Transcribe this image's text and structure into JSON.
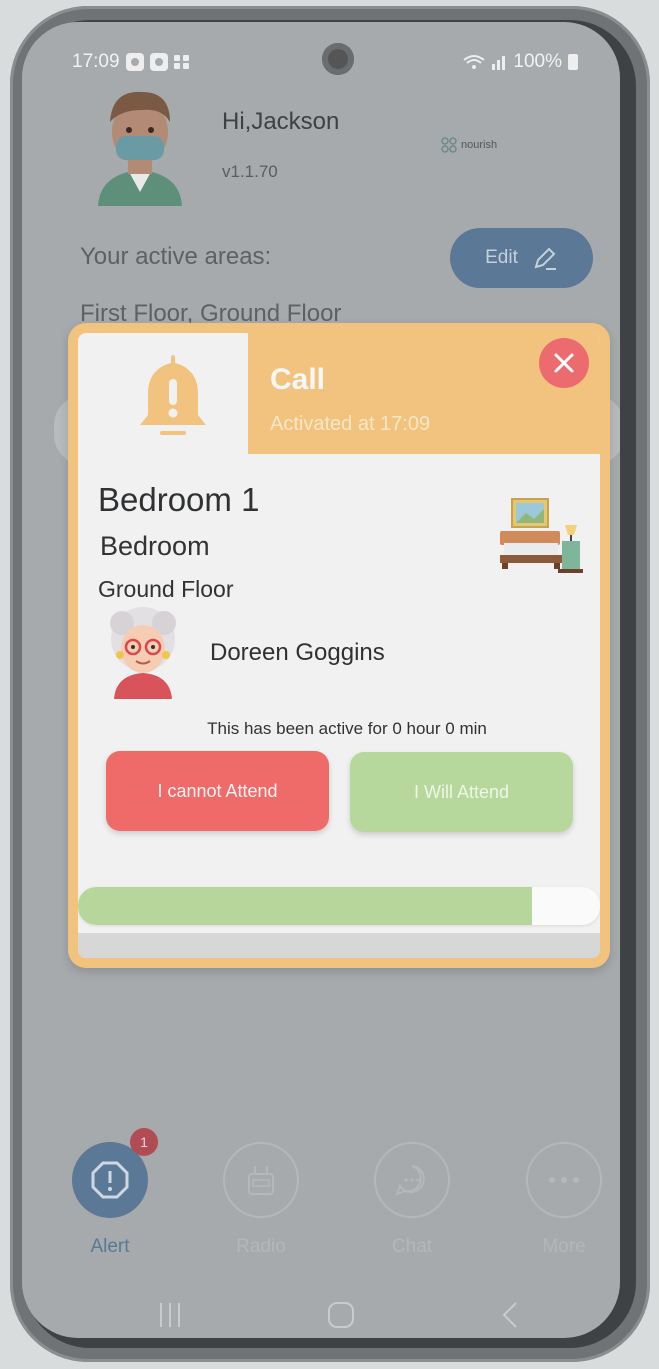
{
  "status_bar": {
    "time": "17:09",
    "battery": "100%"
  },
  "header": {
    "greeting": "Hi,Jackson",
    "version": "v1.1.70",
    "brand": "nourish"
  },
  "areas": {
    "label": "Your active areas:",
    "value": "First Floor, Ground Floor",
    "edit_label": "Edit"
  },
  "alert": {
    "title": "Call",
    "activated": "Activated at 17:09",
    "room_name": "Bedroom 1",
    "room_type": "Bedroom",
    "floor": "Ground Floor",
    "resident": "Doreen Goggins",
    "active_text": "This has been active for 0 hour 0 min",
    "cannot_attend": "I cannot Attend",
    "will_attend": "I Will Attend",
    "timer_progress": 0.87
  },
  "nav": {
    "items": [
      {
        "label": "Alert",
        "badge": "1"
      },
      {
        "label": "Radio"
      },
      {
        "label": "Chat"
      },
      {
        "label": "More"
      }
    ]
  },
  "colors": {
    "accent": "#5b7897",
    "alert": "#f2c37e",
    "danger": "#ee6b6a",
    "success": "#b7d89d"
  }
}
